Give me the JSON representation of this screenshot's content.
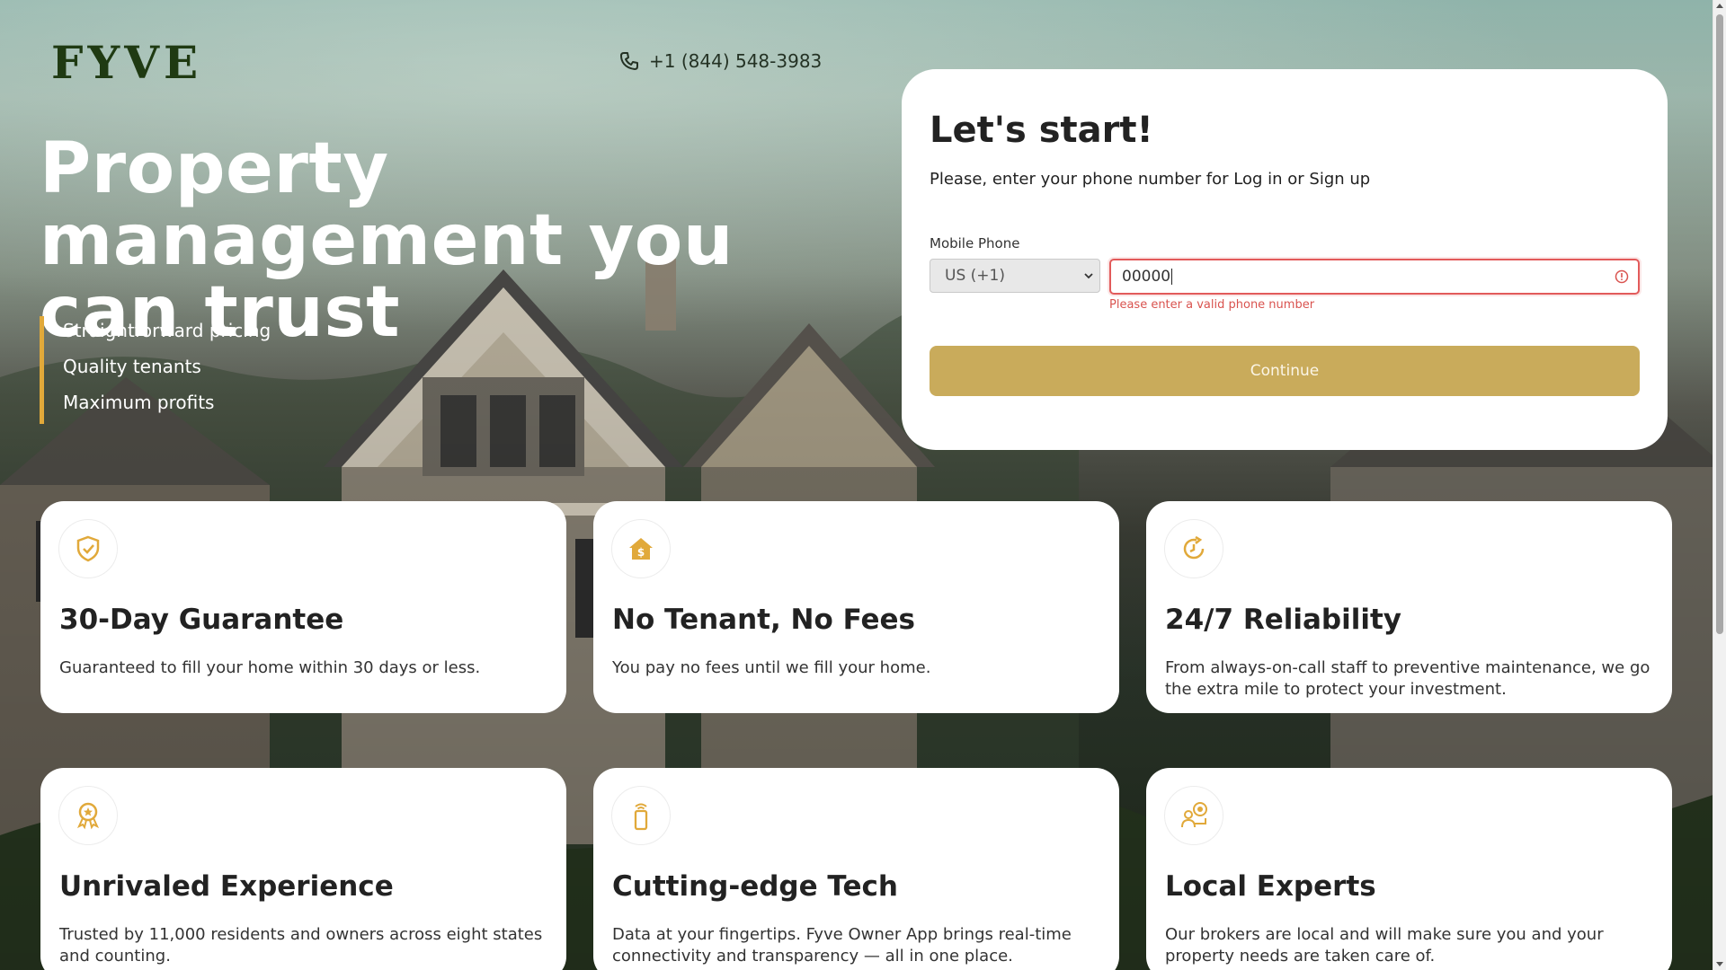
{
  "brand": {
    "logo": "FYVE",
    "accent": "#e1a93a",
    "button_color": "#c9ab5b"
  },
  "header": {
    "phone": "+1 (844) 548-3983",
    "phone_icon": "phone-icon"
  },
  "hero": {
    "title": "Property management you can trust",
    "bullets": [
      "Straightforward pricing",
      "Quality tenants",
      "Maximum profits"
    ]
  },
  "login": {
    "title": "Let's start!",
    "subtitle": "Please, enter your phone number for Log in or Sign up",
    "field_label": "Mobile Phone",
    "country_select": "US (+1)",
    "phone_value": "00000",
    "error": "Please enter a valid phone number",
    "continue_label": "Continue"
  },
  "features": [
    {
      "icon": "shield-check-icon",
      "title": "30-Day Guarantee",
      "text": "Guaranteed to fill your home within 30 days or less."
    },
    {
      "icon": "house-dollar-icon",
      "title": "No Tenant, No Fees",
      "text": "You pay no fees until we fill your home."
    },
    {
      "icon": "clock-cycle-icon",
      "title": "24/7 Reliability",
      "text": "From always-on-call staff to preventive maintenance, we go the extra mile to protect your investment."
    },
    {
      "icon": "award-ribbon-icon",
      "title": "Unrivaled Experience",
      "text": "Trusted by 11,000 residents and owners across eight states and counting."
    },
    {
      "icon": "mobile-signal-icon",
      "title": "Cutting-edge Tech",
      "text": "Data at your fingertips. Fyve Owner App brings real-time connectivity and transparency — all in one place."
    },
    {
      "icon": "experts-chat-icon",
      "title": "Local Experts",
      "text": "Our brokers are local and will make sure you and your property needs are taken care of."
    }
  ]
}
